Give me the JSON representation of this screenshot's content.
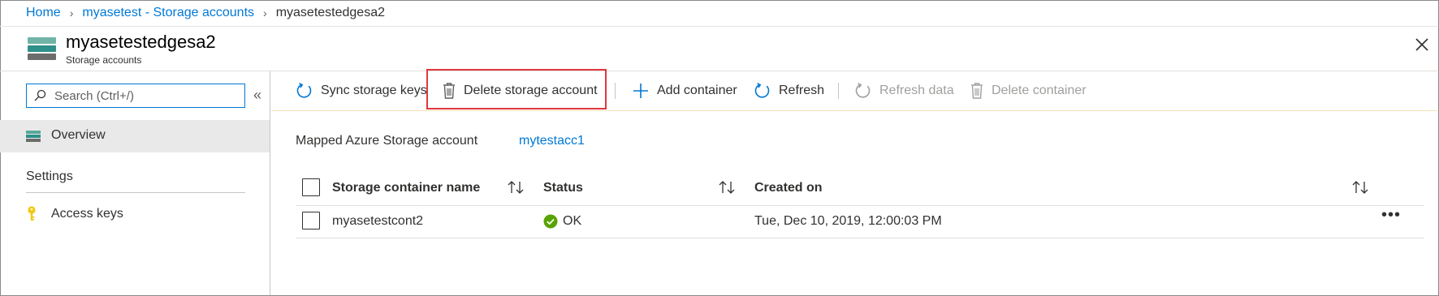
{
  "breadcrumb": {
    "home": "Home",
    "parent": "myasetest - Storage accounts",
    "current": "myasetestedgesa2"
  },
  "header": {
    "title": "myasetestedgesa2",
    "subtitle": "Storage accounts"
  },
  "sidebar": {
    "search_placeholder": "Search (Ctrl+/)",
    "collapse": "«",
    "overview_label": "Overview",
    "settings_heading": "Settings",
    "access_keys_label": "Access keys"
  },
  "toolbar": {
    "sync": "Sync storage keys",
    "delete_account": "Delete storage account",
    "add_container": "Add container",
    "refresh": "Refresh",
    "refresh_data": "Refresh data",
    "delete_container": "Delete container"
  },
  "content": {
    "mapped_label": "Mapped Azure Storage account",
    "mapped_value": "mytestacc1",
    "columns": {
      "name": "Storage container name",
      "status": "Status",
      "created": "Created on"
    },
    "rows": [
      {
        "name": "myasetestcont2",
        "status": "OK",
        "created": "Tue, Dec 10, 2019, 12:00:03 PM",
        "more": "•••"
      }
    ]
  },
  "colors": {
    "accent": "#0078d4",
    "highlight": "#e0383d",
    "ok": "#57a300"
  }
}
